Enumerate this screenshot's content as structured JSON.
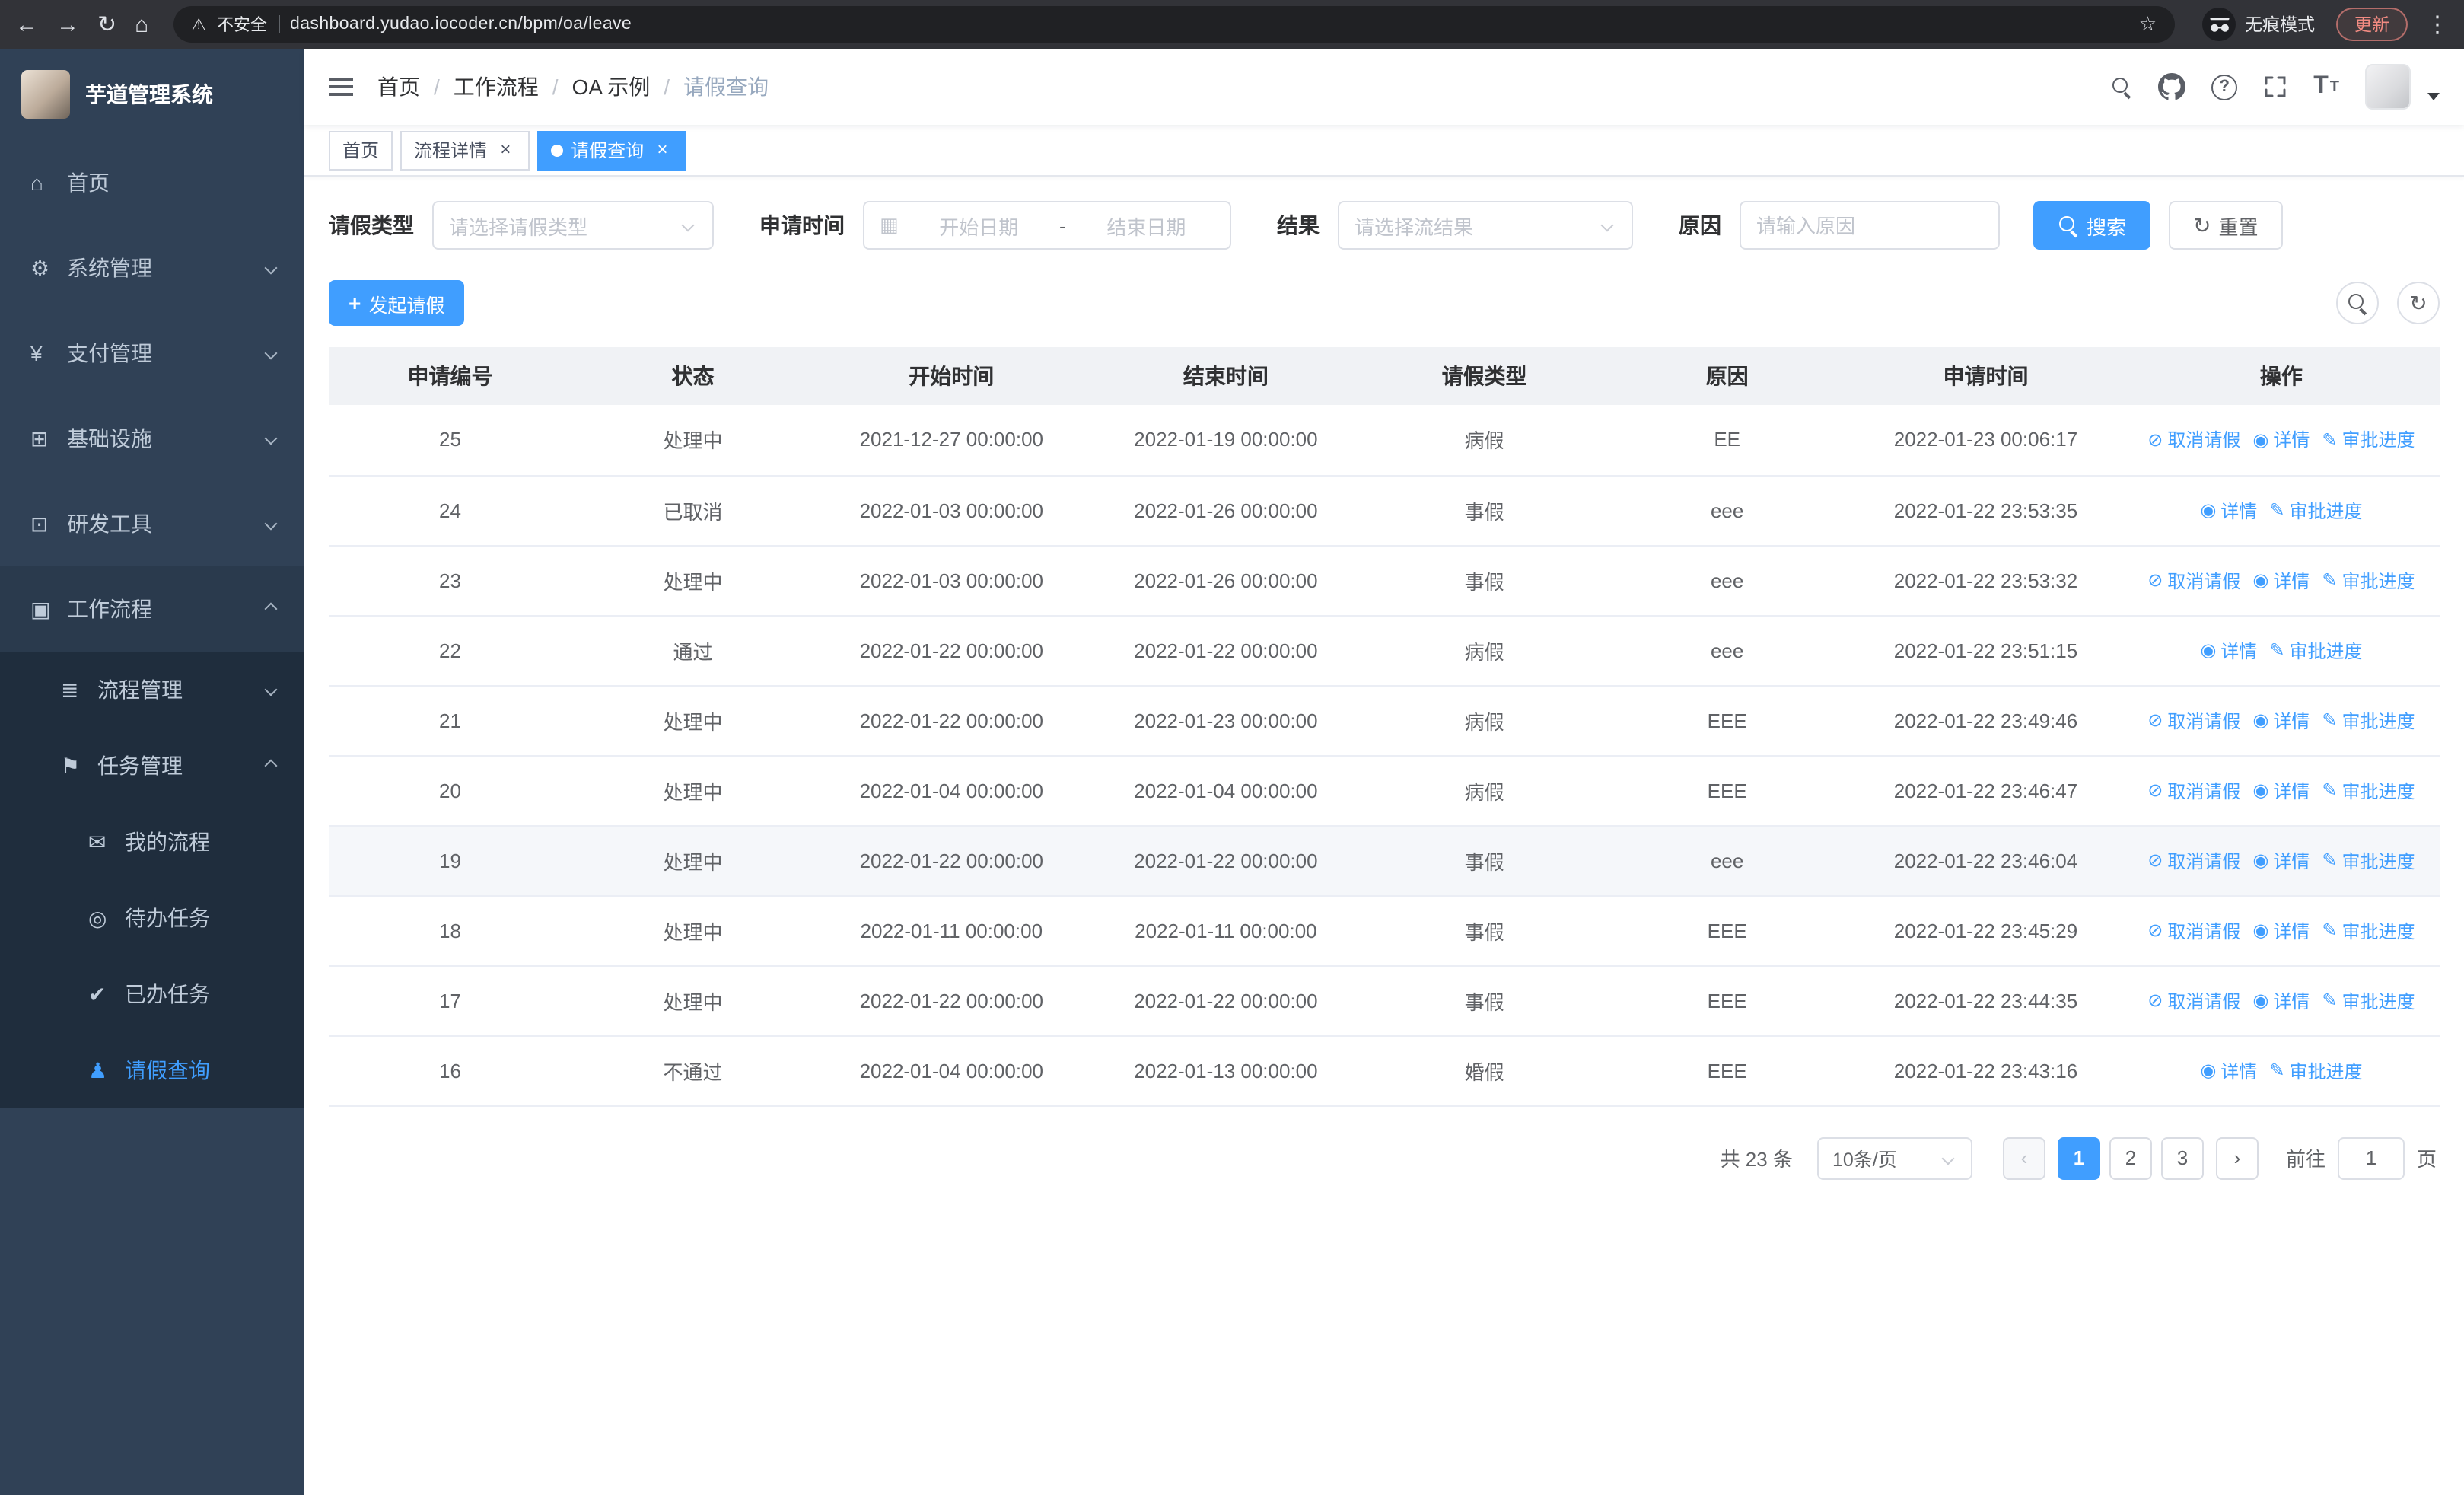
{
  "theme": {
    "primary": "#409EFF",
    "sidebar_bg": "#304156",
    "submenu_bg": "#1f2d3d",
    "chrome_bg": "#323338",
    "update_color": "#f28b82"
  },
  "browser": {
    "security_label": "不安全",
    "url": "dashboard.yudao.iocoder.cn/bpm/oa/leave",
    "incognito_label": "无痕模式",
    "update_label": "更新"
  },
  "icons": {
    "back": "←",
    "forward": "→",
    "reload": "↻",
    "home": "⌂",
    "warning": "⚠",
    "star": "☆",
    "kebab": "⋮",
    "close": "×",
    "calendar": "▦",
    "plus": "+",
    "refresh": "↻",
    "question": "?",
    "font_size_large": "T",
    "font_size_small": "T",
    "prev": "‹",
    "next": "›"
  },
  "sidebar": {
    "title": "芋道管理系统",
    "items": [
      {
        "key": "home",
        "label": "首页",
        "icon": "dashboard-icon",
        "glyph": "⌂",
        "level": 0
      },
      {
        "key": "system",
        "label": "系统管理",
        "icon": "gear-icon",
        "glyph": "⚙",
        "level": 0,
        "arrow": "down"
      },
      {
        "key": "payment",
        "label": "支付管理",
        "icon": "yen-icon",
        "glyph": "¥",
        "level": 0,
        "arrow": "down"
      },
      {
        "key": "infrastructure",
        "label": "基础设施",
        "icon": "monitor-icon",
        "glyph": "⊞",
        "level": 0,
        "arrow": "down"
      },
      {
        "key": "devtools",
        "label": "研发工具",
        "icon": "tools-icon",
        "glyph": "⊡",
        "level": 0,
        "arrow": "down"
      },
      {
        "key": "workflow",
        "label": "工作流程",
        "icon": "briefcase-icon",
        "glyph": "▣",
        "level": 0,
        "arrow": "up",
        "open": true
      },
      {
        "key": "process-mgmt",
        "label": "流程管理",
        "icon": "list-icon",
        "glyph": "≣",
        "level": 1,
        "arrow": "down"
      },
      {
        "key": "task-mgmt",
        "label": "任务管理",
        "icon": "flag-icon",
        "glyph": "⚑",
        "level": 1,
        "arrow": "up",
        "open": true
      },
      {
        "key": "my-process",
        "label": "我的流程",
        "icon": "message-icon",
        "glyph": "✉",
        "level": 2
      },
      {
        "key": "todo-tasks",
        "label": "待办任务",
        "icon": "eye-icon",
        "glyph": "◎",
        "level": 2
      },
      {
        "key": "done-tasks",
        "label": "已办任务",
        "icon": "check-icon",
        "glyph": "✔",
        "level": 2
      },
      {
        "key": "leave-query",
        "label": "请假查询",
        "icon": "user-icon",
        "glyph": "♟",
        "level": 2,
        "active": true
      }
    ]
  },
  "navbar": {
    "breadcrumb": [
      "首页",
      "工作流程",
      "OA 示例",
      "请假查询"
    ]
  },
  "tabs": [
    {
      "key": "home",
      "label": "首页",
      "closable": false,
      "active": false
    },
    {
      "key": "process-detail",
      "label": "流程详情",
      "closable": true,
      "active": false
    },
    {
      "key": "leave-query",
      "label": "请假查询",
      "closable": true,
      "active": true
    }
  ],
  "filters": {
    "leave_type_label": "请假类型",
    "leave_type_placeholder": "请选择请假类型",
    "apply_time_label": "申请时间",
    "date_start_placeholder": "开始日期",
    "date_separator": "-",
    "date_end_placeholder": "结束日期",
    "result_label": "结果",
    "result_placeholder": "请选择流结果",
    "reason_label": "原因",
    "reason_placeholder": "请输入原因",
    "search_label": "搜索",
    "reset_label": "重置"
  },
  "toolbar": {
    "create_label": "发起请假"
  },
  "ops": {
    "cancel": {
      "name": "cancel-leave",
      "label": "取消请假",
      "icon": "delete-icon",
      "glyph": "⊘"
    },
    "detail": {
      "name": "detail",
      "label": "详情",
      "icon": "view-icon",
      "glyph": "◉"
    },
    "progress": {
      "name": "approval-progress",
      "label": "审批进度",
      "icon": "edit-icon",
      "glyph": "✎"
    }
  },
  "table": {
    "columns": [
      "申请编号",
      "状态",
      "开始时间",
      "结束时间",
      "请假类型",
      "原因",
      "申请时间",
      "操作"
    ],
    "rows": [
      {
        "id": "25",
        "status": "处理中",
        "start": "2021-12-27 00:00:00",
        "end": "2022-01-19 00:00:00",
        "type": "病假",
        "reason": "EE",
        "applied": "2022-01-23 00:06:17",
        "ops": [
          "cancel",
          "detail",
          "progress"
        ]
      },
      {
        "id": "24",
        "status": "已取消",
        "start": "2022-01-03 00:00:00",
        "end": "2022-01-26 00:00:00",
        "type": "事假",
        "reason": "eee",
        "applied": "2022-01-22 23:53:35",
        "ops": [
          "detail",
          "progress"
        ]
      },
      {
        "id": "23",
        "status": "处理中",
        "start": "2022-01-03 00:00:00",
        "end": "2022-01-26 00:00:00",
        "type": "事假",
        "reason": "eee",
        "applied": "2022-01-22 23:53:32",
        "ops": [
          "cancel",
          "detail",
          "progress"
        ]
      },
      {
        "id": "22",
        "status": "通过",
        "start": "2022-01-22 00:00:00",
        "end": "2022-01-22 00:00:00",
        "type": "病假",
        "reason": "eee",
        "applied": "2022-01-22 23:51:15",
        "ops": [
          "detail",
          "progress"
        ]
      },
      {
        "id": "21",
        "status": "处理中",
        "start": "2022-01-22 00:00:00",
        "end": "2022-01-23 00:00:00",
        "type": "病假",
        "reason": "EEE",
        "applied": "2022-01-22 23:49:46",
        "ops": [
          "cancel",
          "detail",
          "progress"
        ]
      },
      {
        "id": "20",
        "status": "处理中",
        "start": "2022-01-04 00:00:00",
        "end": "2022-01-04 00:00:00",
        "type": "病假",
        "reason": "EEE",
        "applied": "2022-01-22 23:46:47",
        "ops": [
          "cancel",
          "detail",
          "progress"
        ]
      },
      {
        "id": "19",
        "status": "处理中",
        "start": "2022-01-22 00:00:00",
        "end": "2022-01-22 00:00:00",
        "type": "事假",
        "reason": "eee",
        "applied": "2022-01-22 23:46:04",
        "ops": [
          "cancel",
          "detail",
          "progress"
        ],
        "highlight": true
      },
      {
        "id": "18",
        "status": "处理中",
        "start": "2022-01-11 00:00:00",
        "end": "2022-01-11 00:00:00",
        "type": "事假",
        "reason": "EEE",
        "applied": "2022-01-22 23:45:29",
        "ops": [
          "cancel",
          "detail",
          "progress"
        ]
      },
      {
        "id": "17",
        "status": "处理中",
        "start": "2022-01-22 00:00:00",
        "end": "2022-01-22 00:00:00",
        "type": "事假",
        "reason": "EEE",
        "applied": "2022-01-22 23:44:35",
        "ops": [
          "cancel",
          "detail",
          "progress"
        ]
      },
      {
        "id": "16",
        "status": "不通过",
        "start": "2022-01-04 00:00:00",
        "end": "2022-01-13 00:00:00",
        "type": "婚假",
        "reason": "EEE",
        "applied": "2022-01-22 23:43:16",
        "ops": [
          "detail",
          "progress"
        ]
      }
    ]
  },
  "pagination": {
    "total_text": "共 23 条",
    "page_size_value": "10条/页",
    "pages": [
      "1",
      "2",
      "3"
    ],
    "active_page": "1",
    "goto_label": "前往",
    "goto_value": "1",
    "goto_suffix": "页"
  }
}
